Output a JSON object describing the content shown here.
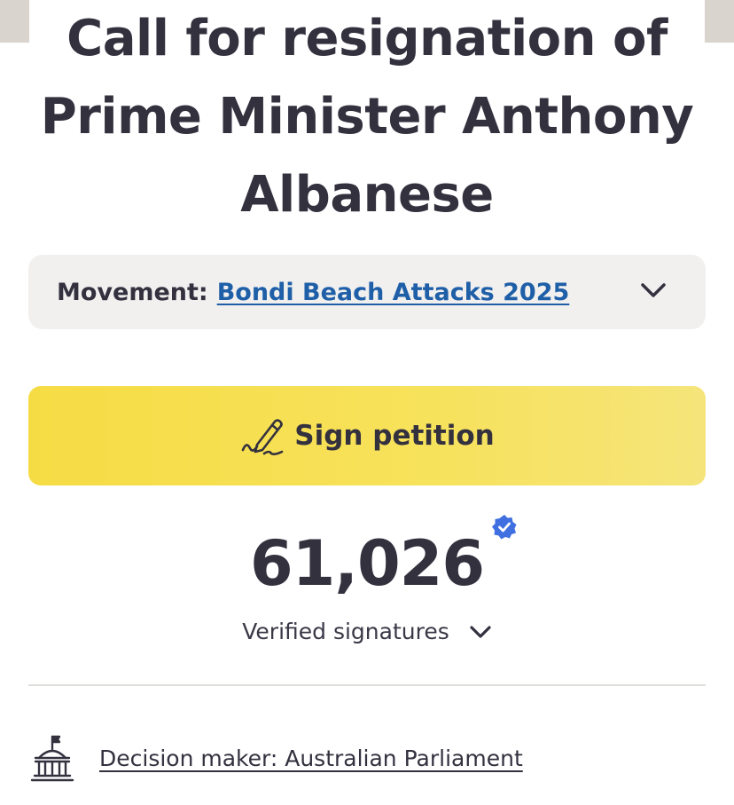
{
  "petition": {
    "title": "Call for resignation of Prime Minister Anthony Albanese"
  },
  "movement": {
    "label": "Movement:",
    "link_text": "Bondi Beach Attacks 2025",
    "toggle_icon": "chevron-down-icon"
  },
  "sign_button": {
    "label": "Sign petition",
    "icon": "pen-signature-icon",
    "color": "#f6dc44"
  },
  "signatures": {
    "count": "61,026",
    "badge_icon": "verified-check-icon",
    "label": "Verified signatures",
    "toggle_icon": "chevron-down-icon"
  },
  "decision_maker": {
    "icon": "parliament-building-icon",
    "text": "Decision maker: Australian Parliament"
  },
  "colors": {
    "text": "#34313f",
    "link": "#1f5fa8",
    "badge": "#3f6fe0",
    "movement_bg": "#f1f0ef"
  }
}
